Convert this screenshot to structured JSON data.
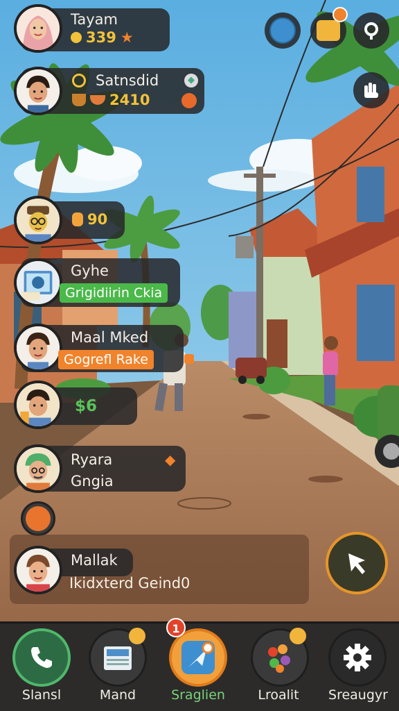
{
  "players": [
    {
      "name": "Tayam",
      "stat": "339"
    },
    {
      "name": "Satnsdid",
      "stat": "2410"
    },
    {
      "name": "",
      "stat": "90"
    },
    {
      "name": "Gyhe",
      "badge": "Grigidiirin Ckia"
    },
    {
      "name": "Maal Mked",
      "badge": "Gogrefl Rake"
    },
    {
      "name": "",
      "stat": "$6"
    },
    {
      "name": "Ryara",
      "sub": "Gngia"
    },
    {
      "name": "Mallak",
      "sub": "Ikidxterd Geind0"
    }
  ],
  "nav": [
    {
      "label": "Slansl",
      "icon": "phone-icon"
    },
    {
      "label": "Mand",
      "icon": "newspaper-icon"
    },
    {
      "label": "Sraglien",
      "icon": "map-icon",
      "notification": "1"
    },
    {
      "label": "Lroalit",
      "icon": "candy-icon"
    },
    {
      "label": "Sreaugyr",
      "icon": "gear-icon"
    }
  ],
  "colors": {
    "accent_green": "#4bb84a",
    "accent_orange": "#f0832b",
    "gold": "#f2c23b",
    "panel": "#28282a"
  }
}
